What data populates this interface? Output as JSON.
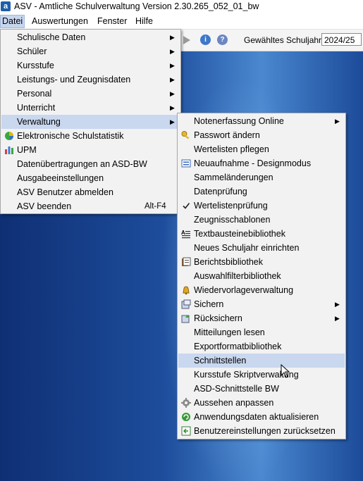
{
  "window": {
    "title": "ASV - Amtliche Schulverwaltung Version 2.30.265_052_01_bw",
    "app_icon_letter": "a"
  },
  "menubar": {
    "items": [
      "Datei",
      "Auswertungen",
      "Fenster",
      "Hilfe"
    ]
  },
  "toolbar": {
    "school_year_label": "Gewähltes Schuljahr",
    "school_year_value": "2024/25"
  },
  "datei_menu": {
    "items": [
      {
        "label": "Schulische Daten",
        "submenu": true
      },
      {
        "label": "Schüler",
        "submenu": true
      },
      {
        "label": "Kursstufe",
        "submenu": true
      },
      {
        "label": "Leistungs- und Zeugnisdaten",
        "submenu": true
      },
      {
        "label": "Personal",
        "submenu": true
      },
      {
        "label": "Unterricht",
        "submenu": true
      },
      {
        "label": "Verwaltung",
        "submenu": true,
        "highlighted": true
      },
      {
        "label": "Elektronische Schulstatistik",
        "icon": "pie-chart-icon"
      },
      {
        "label": "UPM",
        "icon": "bar-chart-icon"
      },
      {
        "label": "Datenübertragungen an ASD-BW"
      },
      {
        "label": "Ausgabeeinstellungen"
      },
      {
        "label": "ASV Benutzer abmelden"
      },
      {
        "label": "ASV beenden",
        "shortcut": "Alt-F4"
      }
    ]
  },
  "verwaltung_menu": {
    "items": [
      {
        "label": "Notenerfassung Online",
        "submenu": true
      },
      {
        "label": "Passwort ändern",
        "icon": "key-icon"
      },
      {
        "label": "Wertelisten pflegen"
      },
      {
        "label": "Neuaufnahme - Designmodus",
        "icon": "form-icon"
      },
      {
        "label": "Sammeländerungen"
      },
      {
        "label": "Datenprüfung"
      },
      {
        "label": "Wertelistenprüfung",
        "icon": "checkmark-icon"
      },
      {
        "label": "Zeugnisschablonen"
      },
      {
        "label": "Textbausteinebibliothek",
        "icon": "text-block-icon"
      },
      {
        "label": "Neues Schuljahr einrichten"
      },
      {
        "label": "Berichtsbibliothek",
        "icon": "report-icon"
      },
      {
        "label": "Auswahlfilterbibliothek"
      },
      {
        "label": "Wiedervorlageverwaltung",
        "icon": "bell-icon"
      },
      {
        "label": "Sichern",
        "icon": "backup-icon",
        "submenu": true
      },
      {
        "label": "Rücksichern",
        "icon": "restore-icon",
        "submenu": true
      },
      {
        "label": "Mitteilungen lesen"
      },
      {
        "label": "Exportformatbibliothek"
      },
      {
        "label": "Schnittstellen",
        "highlighted": true
      },
      {
        "label": "Kursstufe Skriptverwaltung"
      },
      {
        "label": "ASD-Schnittstelle BW"
      },
      {
        "label": "Aussehen anpassen",
        "icon": "gear-icon"
      },
      {
        "label": "Anwendungsdaten aktualisieren",
        "icon": "refresh-icon"
      },
      {
        "label": "Benutzereinstellungen zurücksetzen",
        "icon": "reset-icon"
      }
    ]
  },
  "colors": {
    "highlight": "#c9d7ef",
    "menu_bg": "#f2f2f2",
    "workspace_dark": "#0f2f74",
    "workspace_light": "#4a88cf"
  }
}
